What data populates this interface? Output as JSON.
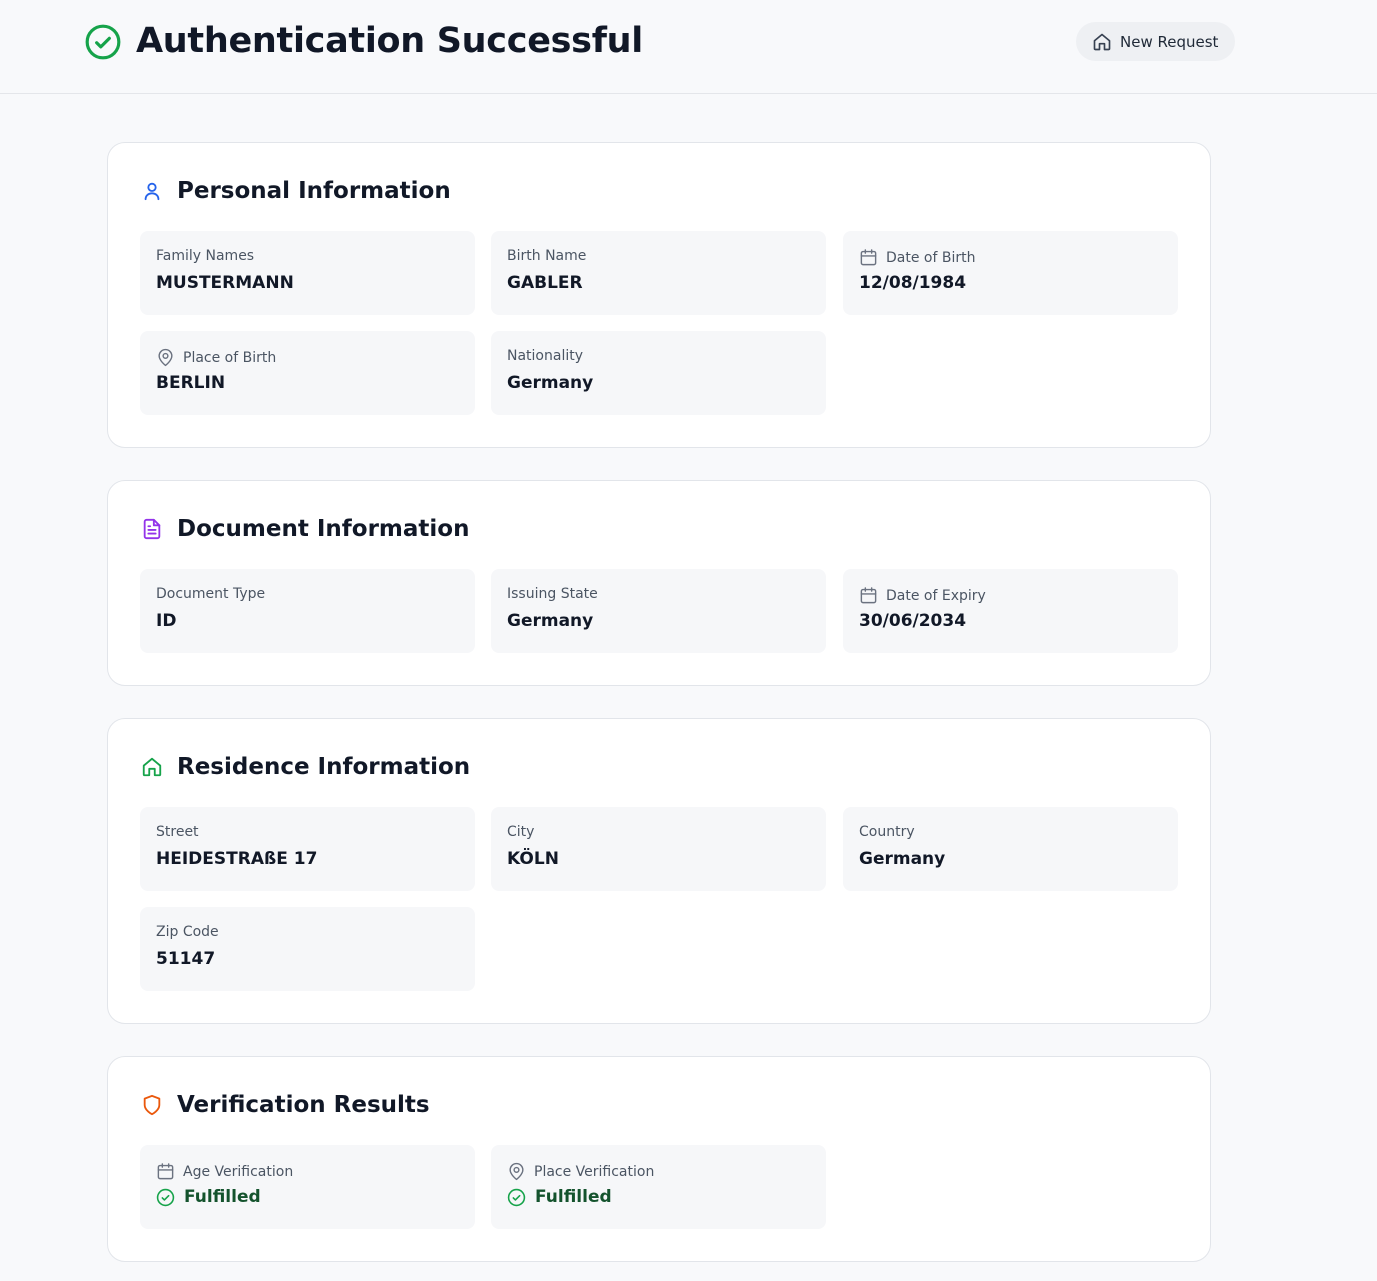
{
  "header": {
    "title": "Authentication Successful",
    "new_request_label": "New Request"
  },
  "colors": {
    "success": "#16a34a",
    "personal_icon": "#2563eb",
    "document_icon": "#9333ea",
    "residence_icon": "#16a34a",
    "verification_icon": "#ea580c"
  },
  "personal": {
    "title": "Personal Information",
    "icon": "user-icon",
    "family_names": {
      "label": "Family Names",
      "value": "MUSTERMANN"
    },
    "birth_name": {
      "label": "Birth Name",
      "value": "GABLER"
    },
    "date_of_birth": {
      "label": "Date of Birth",
      "value": "12/08/1984",
      "icon": "calendar-icon"
    },
    "place_of_birth": {
      "label": "Place of Birth",
      "value": "BERLIN",
      "icon": "map-pin-icon"
    },
    "nationality": {
      "label": "Nationality",
      "value": "Germany"
    }
  },
  "document": {
    "title": "Document Information",
    "icon": "file-text-icon",
    "document_type": {
      "label": "Document Type",
      "value": "ID"
    },
    "issuing_state": {
      "label": "Issuing State",
      "value": "Germany"
    },
    "date_of_expiry": {
      "label": "Date of Expiry",
      "value": "30/06/2034",
      "icon": "calendar-icon"
    }
  },
  "residence": {
    "title": "Residence Information",
    "icon": "home-icon",
    "street": {
      "label": "Street",
      "value": "HEIDESTRAßE 17"
    },
    "city": {
      "label": "City",
      "value": "KÖLN"
    },
    "country": {
      "label": "Country",
      "value": "Germany"
    },
    "zip_code": {
      "label": "Zip Code",
      "value": "51147"
    }
  },
  "verification": {
    "title": "Verification Results",
    "icon": "shield-icon",
    "age": {
      "label": "Age Verification",
      "value": "Fulfilled",
      "icon": "calendar-icon",
      "status_icon": "check-circle-icon"
    },
    "place": {
      "label": "Place Verification",
      "value": "Fulfilled",
      "icon": "map-pin-icon",
      "status_icon": "check-circle-icon"
    }
  }
}
